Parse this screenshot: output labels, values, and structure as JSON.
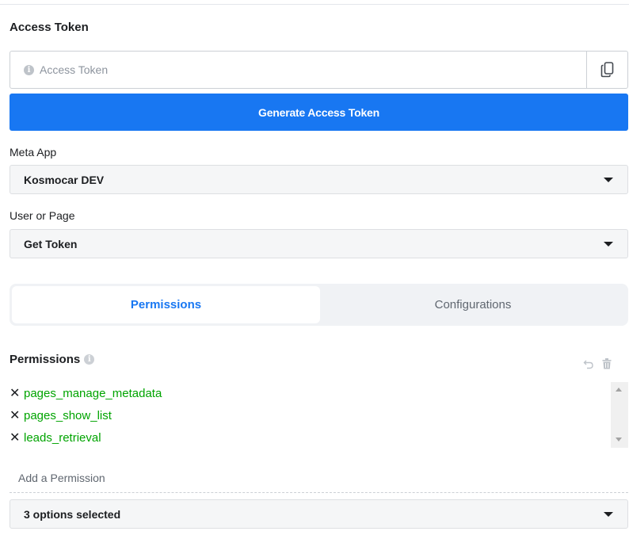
{
  "header": {
    "section_title": "Access Token"
  },
  "access_token": {
    "placeholder": "Access Token",
    "value": ""
  },
  "generate_button": {
    "label": "Generate Access Token"
  },
  "meta_app": {
    "label": "Meta App",
    "selected": "Kosmocar DEV"
  },
  "user_or_page": {
    "label": "User or Page",
    "selected": "Get Token"
  },
  "tabs": [
    {
      "label": "Permissions",
      "active": true
    },
    {
      "label": "Configurations",
      "active": false
    }
  ],
  "permissions": {
    "title": "Permissions",
    "items": [
      "pages_manage_metadata",
      "pages_show_list",
      "leads_retrieval"
    ],
    "add_placeholder": "Add a Permission",
    "selected_summary": "3 options selected"
  },
  "icons": {
    "info": "info-icon",
    "copy": "copy-icon",
    "caret": "caret-down-icon",
    "undo": "undo-icon",
    "trash": "trash-icon",
    "remove": "close-icon"
  },
  "colors": {
    "primary": "#1877f2",
    "permission_green": "#00a400",
    "field_bg": "#f5f6f7"
  }
}
